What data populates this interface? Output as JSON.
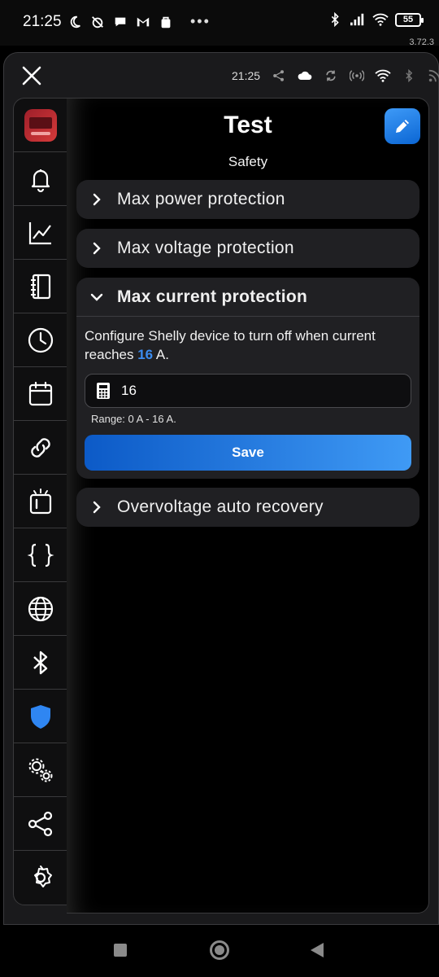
{
  "status_bar": {
    "time": "21:25",
    "battery": "55",
    "app_version": "3.72.3"
  },
  "window": {
    "time": "21:25"
  },
  "page": {
    "title": "Test",
    "subtitle": "Safety"
  },
  "accordions": [
    {
      "label": "Max power protection",
      "expanded": false
    },
    {
      "label": "Max voltage protection",
      "expanded": false
    },
    {
      "label": "Max current protection",
      "expanded": true
    },
    {
      "label": "Overvoltage auto recovery",
      "expanded": false
    }
  ],
  "current_protection": {
    "description_before": "Configure Shelly device to turn off when current reaches ",
    "highlight_value": "16",
    "description_after": " A.",
    "input_value": "16",
    "range_text": "Range: 0 A - 16 A.",
    "save_label": "Save"
  },
  "sidebar": {
    "items": [
      {
        "icon": "device-thumbnail"
      },
      {
        "icon": "bell-icon"
      },
      {
        "icon": "chart-icon"
      },
      {
        "icon": "notebook-icon"
      },
      {
        "icon": "clock-icon"
      },
      {
        "icon": "calendar-icon"
      },
      {
        "icon": "link-icon"
      },
      {
        "icon": "switch-icon"
      },
      {
        "icon": "braces-icon"
      },
      {
        "icon": "globe-icon"
      },
      {
        "icon": "bluetooth-icon"
      },
      {
        "icon": "shield-icon",
        "active": true
      },
      {
        "icon": "gears-icon"
      },
      {
        "icon": "share-icon"
      },
      {
        "icon": "settings-icon"
      }
    ]
  },
  "colors": {
    "accent": "#3b8cf0",
    "active_shield": "#2f86f2",
    "panel": "#202023",
    "background": "#000000"
  }
}
